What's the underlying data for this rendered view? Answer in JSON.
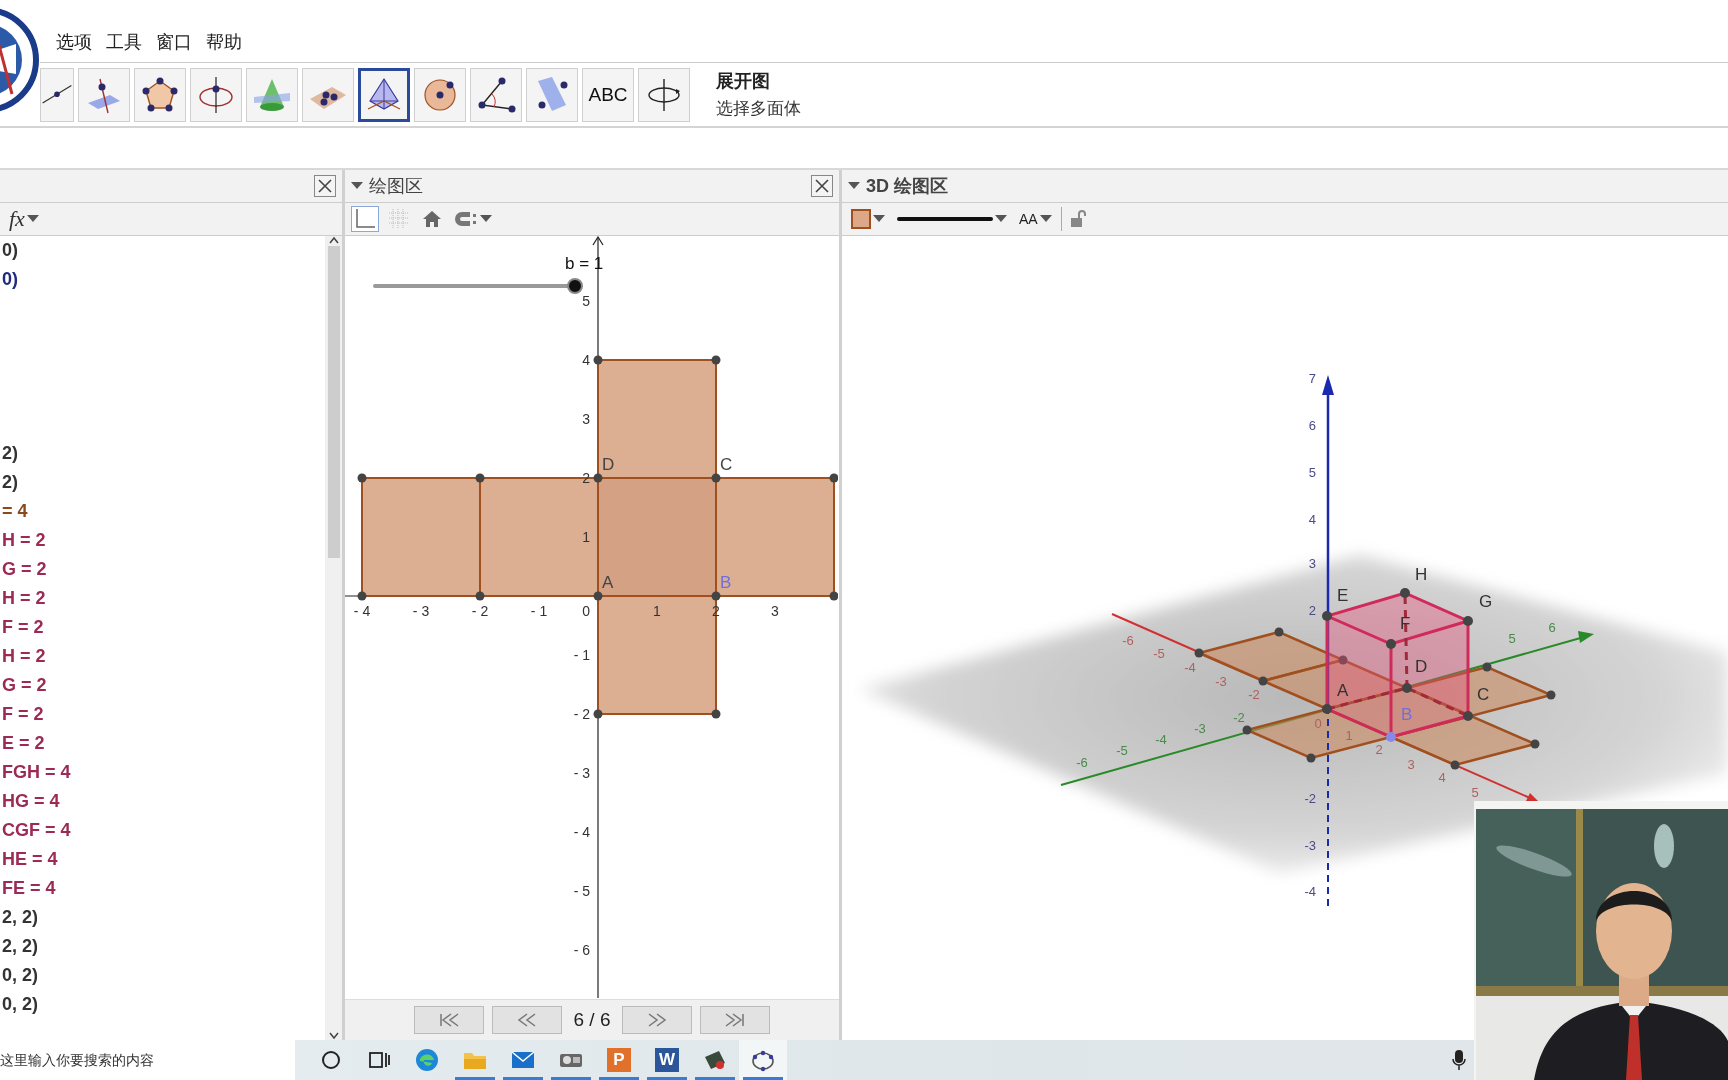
{
  "menu": {
    "items": [
      "选项",
      "工具",
      "窗口",
      "帮助"
    ]
  },
  "toolbar": {
    "tools": [
      {
        "kind": "line",
        "selected": false
      },
      {
        "kind": "perpendicular",
        "selected": false
      },
      {
        "kind": "polygon",
        "selected": false
      },
      {
        "kind": "circle-axis",
        "selected": false
      },
      {
        "kind": "cone",
        "selected": false
      },
      {
        "kind": "plane-points",
        "selected": false
      },
      {
        "kind": "net",
        "selected": true
      },
      {
        "kind": "sphere",
        "selected": false
      },
      {
        "kind": "angle",
        "selected": false
      },
      {
        "kind": "plane",
        "selected": false
      },
      {
        "kind": "text",
        "label": "ABC",
        "selected": false
      },
      {
        "kind": "rotate",
        "selected": false
      }
    ],
    "tool_name": "展开图",
    "tool_help": "选择多面体"
  },
  "algebra": {
    "stylebar_label": "fx",
    "groups": [
      [
        {
          "text": "0)",
          "color": "#333333"
        },
        {
          "text": "0)",
          "color": "#1f2a80"
        }
      ],
      [
        {
          "text": "2)",
          "color": "#333333"
        },
        {
          "text": "2)",
          "color": "#333333"
        },
        {
          "text": "= 4",
          "color": "#8a4a1a"
        },
        {
          "text": "H = 2",
          "color": "#9c2a55"
        },
        {
          "text": "G = 2",
          "color": "#9c2a55"
        },
        {
          "text": "H = 2",
          "color": "#9c2a55"
        },
        {
          "text": "F = 2",
          "color": "#9c2a55"
        },
        {
          "text": "H = 2",
          "color": "#9c2a55"
        },
        {
          "text": "G = 2",
          "color": "#9c2a55"
        },
        {
          "text": "F = 2",
          "color": "#9c2a55"
        },
        {
          "text": "E = 2",
          "color": "#9c2a55"
        },
        {
          "text": "FGH = 4",
          "color": "#9c2a55"
        },
        {
          "text": "HG = 4",
          "color": "#9c2a55"
        },
        {
          "text": "CGF = 4",
          "color": "#9c2a55"
        },
        {
          "text": "HE = 4",
          "color": "#9c2a55"
        },
        {
          "text": "FE = 4",
          "color": "#9c2a55"
        },
        {
          "text": "2, 2)",
          "color": "#333333"
        },
        {
          "text": "2, 2)",
          "color": "#333333"
        },
        {
          "text": "0, 2)",
          "color": "#333333"
        },
        {
          "text": "0, 2)",
          "color": "#333333"
        }
      ]
    ]
  },
  "graphics": {
    "title": "绘图区",
    "stylebar": [
      {
        "kind": "axes",
        "selected": true
      },
      {
        "kind": "grid",
        "selected": false
      },
      {
        "kind": "home",
        "selected": false
      },
      {
        "kind": "capture",
        "selected": false
      }
    ],
    "slider": {
      "label": "b = 1",
      "level": 1
    },
    "x_ticks": [
      "- 4",
      "- 3",
      "- 2",
      "- 1",
      "1",
      "2",
      "3"
    ],
    "y_ticks": [
      "5",
      "4",
      "3",
      "2",
      "1",
      "- 1",
      "- 2",
      "- 3",
      "- 4",
      "- 5",
      "- 6"
    ],
    "origin_label": "0",
    "points": [
      {
        "label": "D",
        "color": "#444444"
      },
      {
        "label": "C",
        "color": "#444444"
      },
      {
        "label": "A",
        "color": "#444444"
      },
      {
        "label": "B",
        "color": "#7070d8"
      }
    ],
    "nav": {
      "counter": "6 / 6"
    }
  },
  "view3d": {
    "title": "3D 绘图区",
    "label_style": "AA",
    "z_ticks": [
      "7",
      "6",
      "5",
      "4",
      "3",
      "2",
      "-2",
      "-3",
      "-4"
    ],
    "x_ticks": [
      "-6",
      "-5",
      "-4",
      "-3",
      "-2",
      "0",
      "1",
      "2",
      "3",
      "4",
      "5"
    ],
    "y_ticks": [
      "-6",
      "-5",
      "-4",
      "-3",
      "-2",
      "5",
      "6"
    ],
    "points": [
      {
        "label": "E",
        "color": "#333333"
      },
      {
        "label": "H",
        "color": "#333333"
      },
      {
        "label": "G",
        "color": "#333333"
      },
      {
        "label": "F",
        "color": "#333333"
      },
      {
        "label": "D",
        "color": "#333333"
      },
      {
        "label": "A",
        "color": "#333333"
      },
      {
        "label": "C",
        "color": "#333333"
      },
      {
        "label": "B",
        "color": "#7070d8"
      }
    ]
  },
  "taskbar": {
    "placeholder": "这里输入你要搜索的内容",
    "items": [
      {
        "kind": "search-circle",
        "open": false,
        "selected": false
      },
      {
        "kind": "task-view",
        "open": false,
        "selected": false
      },
      {
        "kind": "browser",
        "open": false,
        "selected": false
      },
      {
        "kind": "folder",
        "open": true,
        "selected": false
      },
      {
        "kind": "mail",
        "open": true,
        "selected": false
      },
      {
        "kind": "projector",
        "open": true,
        "selected": false
      },
      {
        "kind": "letter",
        "glyph": "P",
        "color": "#e0702a",
        "open": true,
        "selected": false
      },
      {
        "kind": "letter",
        "glyph": "W",
        "color": "#2b579a",
        "open": true,
        "selected": false
      },
      {
        "kind": "card",
        "open": true,
        "selected": false
      },
      {
        "kind": "ellipse",
        "open": true,
        "selected": true
      }
    ]
  }
}
